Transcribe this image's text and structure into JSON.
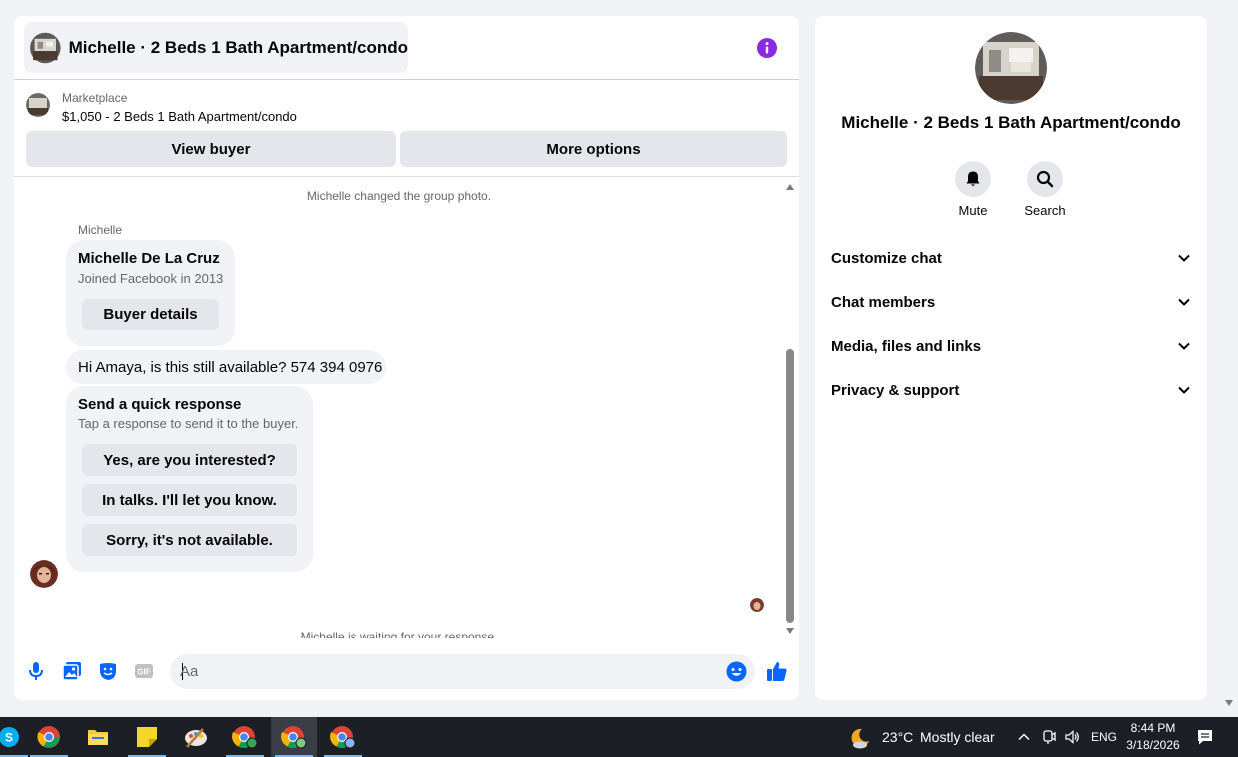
{
  "chat": {
    "title": "Michelle · 2 Beds 1 Bath Apartment/condo",
    "listing": {
      "source": "Marketplace",
      "price_title": "$1,050 - 2 Beds 1 Bath Apartment/condo"
    },
    "buttons": {
      "view_buyer": "View buyer",
      "more_options": "More options"
    },
    "system_photo_note": "Michelle changed the group photo.",
    "sender_label": "Michelle",
    "buyer_card": {
      "name": "Michelle De La Cruz",
      "joined": "Joined Facebook in 2013",
      "button": "Buyer details"
    },
    "buyer_message": "Hi Amaya, is this still available? 574 394 0976",
    "quick_response": {
      "title": "Send a quick response",
      "subtitle": "Tap a response to send it to the buyer.",
      "options": [
        "Yes, are you interested?",
        "In talks. I'll let you know.",
        "Sorry, it's not available."
      ]
    },
    "waiting_note": "Michelle is waiting for your response.",
    "composer": {
      "placeholder": "Aa",
      "icons": [
        "microphone-icon",
        "photo-icon",
        "sticker-icon",
        "gif-icon",
        "emoji-icon",
        "like-icon"
      ],
      "gif_label": "GIF"
    },
    "accent_color": "#0866ff",
    "info_color": "#8a2be2"
  },
  "details": {
    "title": "Michelle · 2 Beds 1 Bath Apartment/condo",
    "actions": [
      {
        "label": "Mute",
        "icon": "bell-icon"
      },
      {
        "label": "Search",
        "icon": "search-icon"
      }
    ],
    "sections": [
      "Customize chat",
      "Chat members",
      "Media, files and links",
      "Privacy & support"
    ]
  },
  "taskbar": {
    "apps": [
      "skype-icon",
      "chrome-icon",
      "file-explorer-icon",
      "sticky-notes-icon",
      "paint-icon",
      "chrome-profile-icon",
      "chrome-profile-icon",
      "chrome-profile-icon"
    ],
    "weather_temp": "23°C",
    "weather_condition": "Mostly clear",
    "language": "ENG",
    "time": "8:44 PM",
    "date": "3/18/2026"
  }
}
